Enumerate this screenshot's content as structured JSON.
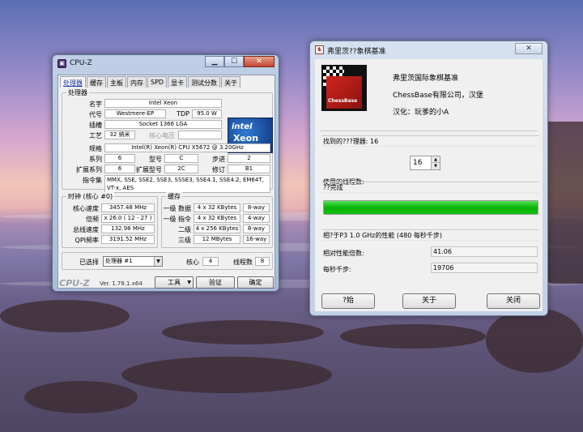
{
  "cpuz": {
    "window_title": "CPU-Z",
    "controls": {
      "minimize": "▁",
      "maximize": "☐",
      "close": "✕"
    },
    "tabs": [
      {
        "label": "处理器",
        "active": true
      },
      {
        "label": "缓存"
      },
      {
        "label": "主板"
      },
      {
        "label": "内存"
      },
      {
        "label": "SPD"
      },
      {
        "label": "显卡"
      },
      {
        "label": "测试分数"
      },
      {
        "label": "关于"
      }
    ],
    "processor": {
      "group_title": "处理器",
      "name_label": "名字",
      "name": "Intel Xeon",
      "codename_label": "代号",
      "codename": "Westmere-EP",
      "tdp_label": "TDP",
      "tdp": "95.0 W",
      "socket_label": "插槽",
      "socket": "Socket 1366 LGA",
      "tech_label": "工艺",
      "tech": "32 纳米",
      "voltage_label": "核心电压",
      "spec_label": "规格",
      "spec": "Intel(R) Xeon(R) CPU           X5672  @ 3.20GHz",
      "family_label": "系列",
      "family": "6",
      "model_label": "型号",
      "model": "C",
      "stepping_label": "步进",
      "stepping": "2",
      "ext_family_label": "扩展系列",
      "ext_family": "6",
      "ext_model_label": "扩展型号",
      "ext_model": "2C",
      "revision_label": "修订",
      "revision": "B1",
      "instr_label": "指令集",
      "instructions": "MMX, SSE, SSE2, SSE3, SSSE3, SSE4.1, SSE4.2, EM64T, VT-x, AES",
      "logo": {
        "line1": "intel",
        "line2": "Xeon",
        "line3": "inside"
      }
    },
    "clocks": {
      "group_title": "时钟 (核心 #0)",
      "core_speed_label": "核心速度",
      "core_speed": "3457.48 MHz",
      "multiplier_label": "倍频",
      "multiplier": "x 26.0 ( 12 - 27 )",
      "bus_speed_label": "总线速度",
      "bus_speed": "132.98 MHz",
      "qpi_label": "QPI频率",
      "qpi": "3191.52 MHz"
    },
    "cache": {
      "group_title": "缓存",
      "l1d_label": "一级 数据",
      "l1d": "4 x 32 KBytes",
      "l1d_way": "8-way",
      "l1i_label": "一级 指令",
      "l1i": "4 x 32 KBytes",
      "l1i_way": "4-way",
      "l2_label": "二级",
      "l2": "4 x 256 KBytes",
      "l2_way": "8-way",
      "l3_label": "三级",
      "l3": "12 MBytes",
      "l3_way": "16-way"
    },
    "selection": {
      "selected_label": "已选择",
      "selected": "处理器 #1",
      "cores_label": "核心",
      "cores": "4",
      "threads_label": "线程数",
      "threads": "8"
    },
    "footer": {
      "brand": "CPU-Z",
      "version": "Ver. 1.78.1.x64",
      "tools": "工具",
      "validate": "验证",
      "ok": "确定"
    }
  },
  "chess": {
    "window_title": "弗里茨??象棋基准",
    "close": "✕",
    "logo_text": "ChessBase",
    "app_name": "弗里茨国际象棋基准",
    "company": "ChessBase有限公司，汉堡",
    "localization": "汉化：玩爹的小A",
    "found_processors": "找到的???理器: 16",
    "threads_label": "使用的线程数:",
    "threads_value": "16",
    "status": "??完成",
    "progress_percent": 100,
    "perf_header": "相?于P3 1.0 GHz的性能 (480 每秒千步)",
    "relative_label": "相对性能倍数:",
    "relative_value": "41.06",
    "kns_label": "每秒千步:",
    "kns_value": "19706",
    "buttons": {
      "start": "?始",
      "about": "关于",
      "close": "关闭"
    },
    "progress_color": "#07b207"
  }
}
